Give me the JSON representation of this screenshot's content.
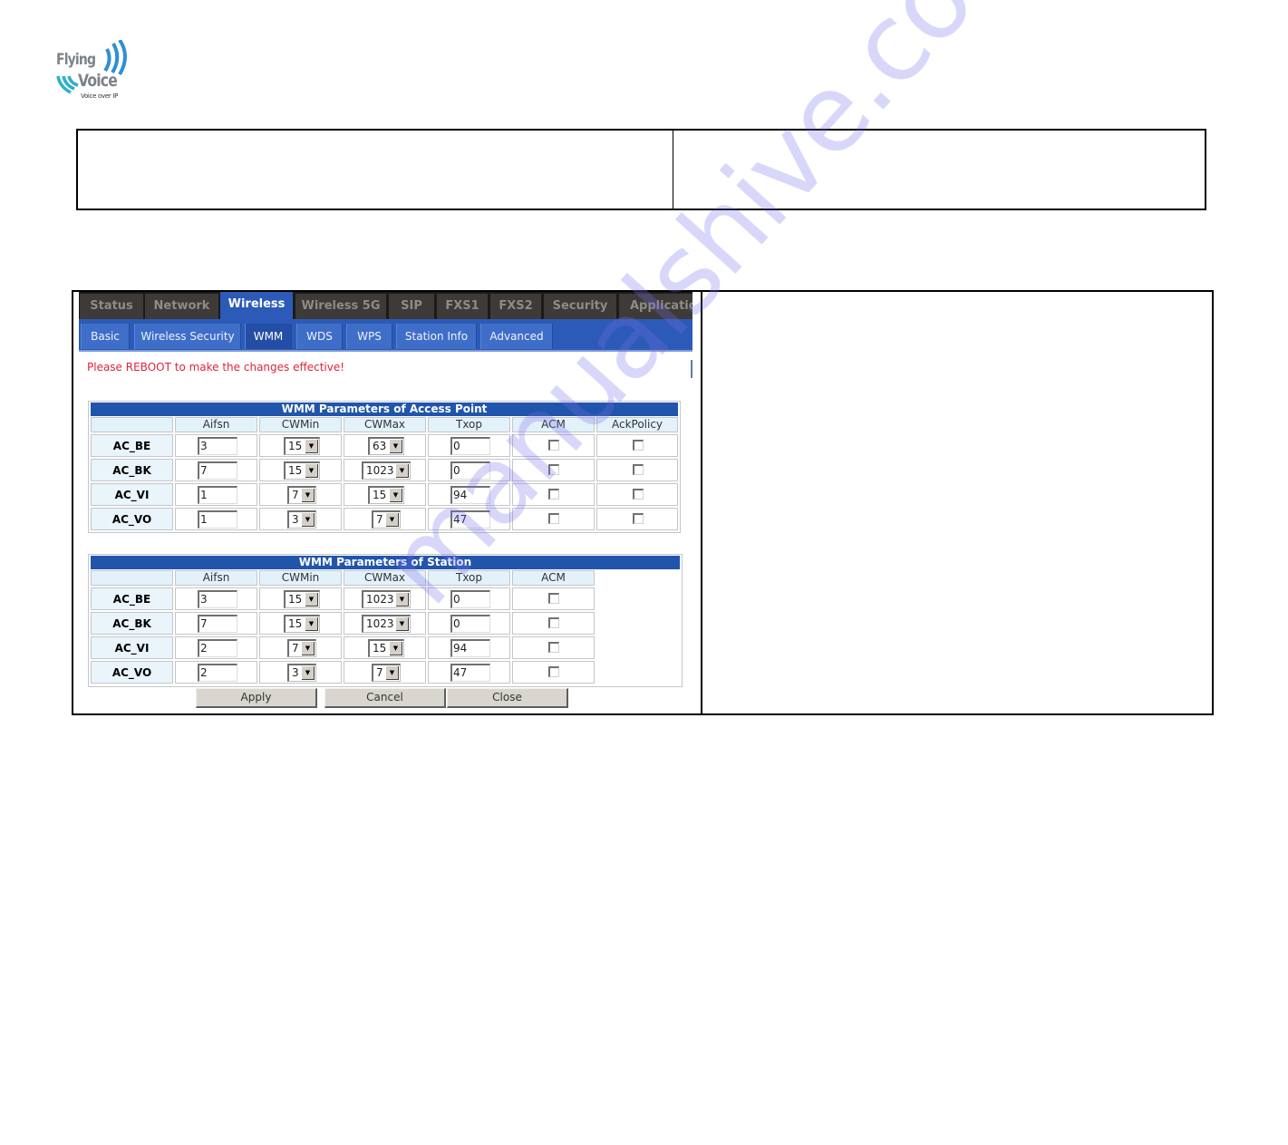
{
  "logo": {
    "line1": "Flying",
    "line2": "Voice",
    "tagline": "Voice over IP",
    "colors": {
      "text": "#7d8287",
      "waves": "#2f8fd8"
    }
  },
  "top_table": {
    "left_cell": "",
    "right_cell": ""
  },
  "router_ui": {
    "main_tabs": [
      {
        "label": "Status",
        "active": false
      },
      {
        "label": "Network",
        "active": false
      },
      {
        "label": "Wireless",
        "active": true
      },
      {
        "label": "Wireless 5G",
        "active": false
      },
      {
        "label": "SIP",
        "active": false
      },
      {
        "label": "FXS1",
        "active": false
      },
      {
        "label": "FXS2",
        "active": false
      },
      {
        "label": "Security",
        "active": false
      },
      {
        "label": "Application",
        "active": false
      }
    ],
    "sub_tabs": [
      {
        "label": "Basic",
        "active": false
      },
      {
        "label": "Wireless Security",
        "active": false
      },
      {
        "label": "WMM",
        "active": true
      },
      {
        "label": "WDS",
        "active": false
      },
      {
        "label": "WPS",
        "active": false
      },
      {
        "label": "Station Info",
        "active": false
      },
      {
        "label": "Advanced",
        "active": false
      }
    ],
    "reboot_notice": "Please REBOOT to make the changes effective!",
    "ap_table": {
      "title": "WMM Parameters of Access Point",
      "columns": [
        "",
        "Aifsn",
        "CWMin",
        "CWMax",
        "Txop",
        "ACM",
        "AckPolicy"
      ],
      "rows": [
        {
          "label": "AC_BE",
          "aifsn": "3",
          "cwmin": "15",
          "cwmax": "63",
          "txop": "0",
          "acm": false,
          "ackpolicy": false
        },
        {
          "label": "AC_BK",
          "aifsn": "7",
          "cwmin": "15",
          "cwmax": "1023",
          "txop": "0",
          "acm": false,
          "ackpolicy": false
        },
        {
          "label": "AC_VI",
          "aifsn": "1",
          "cwmin": "7",
          "cwmax": "15",
          "txop": "94",
          "acm": false,
          "ackpolicy": false
        },
        {
          "label": "AC_VO",
          "aifsn": "1",
          "cwmin": "3",
          "cwmax": "7",
          "txop": "47",
          "acm": false,
          "ackpolicy": false
        }
      ]
    },
    "sta_table": {
      "title": "WMM Parameters of Station",
      "columns": [
        "",
        "Aifsn",
        "CWMin",
        "CWMax",
        "Txop",
        "ACM"
      ],
      "rows": [
        {
          "label": "AC_BE",
          "aifsn": "3",
          "cwmin": "15",
          "cwmax": "1023",
          "txop": "0",
          "acm": false
        },
        {
          "label": "AC_BK",
          "aifsn": "7",
          "cwmin": "15",
          "cwmax": "1023",
          "txop": "0",
          "acm": false
        },
        {
          "label": "AC_VI",
          "aifsn": "2",
          "cwmin": "7",
          "cwmax": "15",
          "txop": "94",
          "acm": false
        },
        {
          "label": "AC_VO",
          "aifsn": "2",
          "cwmin": "3",
          "cwmax": "7",
          "txop": "47",
          "acm": false
        }
      ]
    },
    "buttons": {
      "apply": "Apply",
      "cancel": "Cancel",
      "close": "Close"
    },
    "colors": {
      "tab_bar": "#1b1b1b",
      "tab_inactive": "#3d3a37",
      "tab_active": "#2c5ab8",
      "subtab": "#3f6ec9",
      "table_title": "#2155ab",
      "header_cell": "#e3f1fb",
      "notice": "#e0243a"
    }
  },
  "right_panel": {
    "text": ""
  },
  "watermark": {
    "text": "manualshive.com"
  }
}
